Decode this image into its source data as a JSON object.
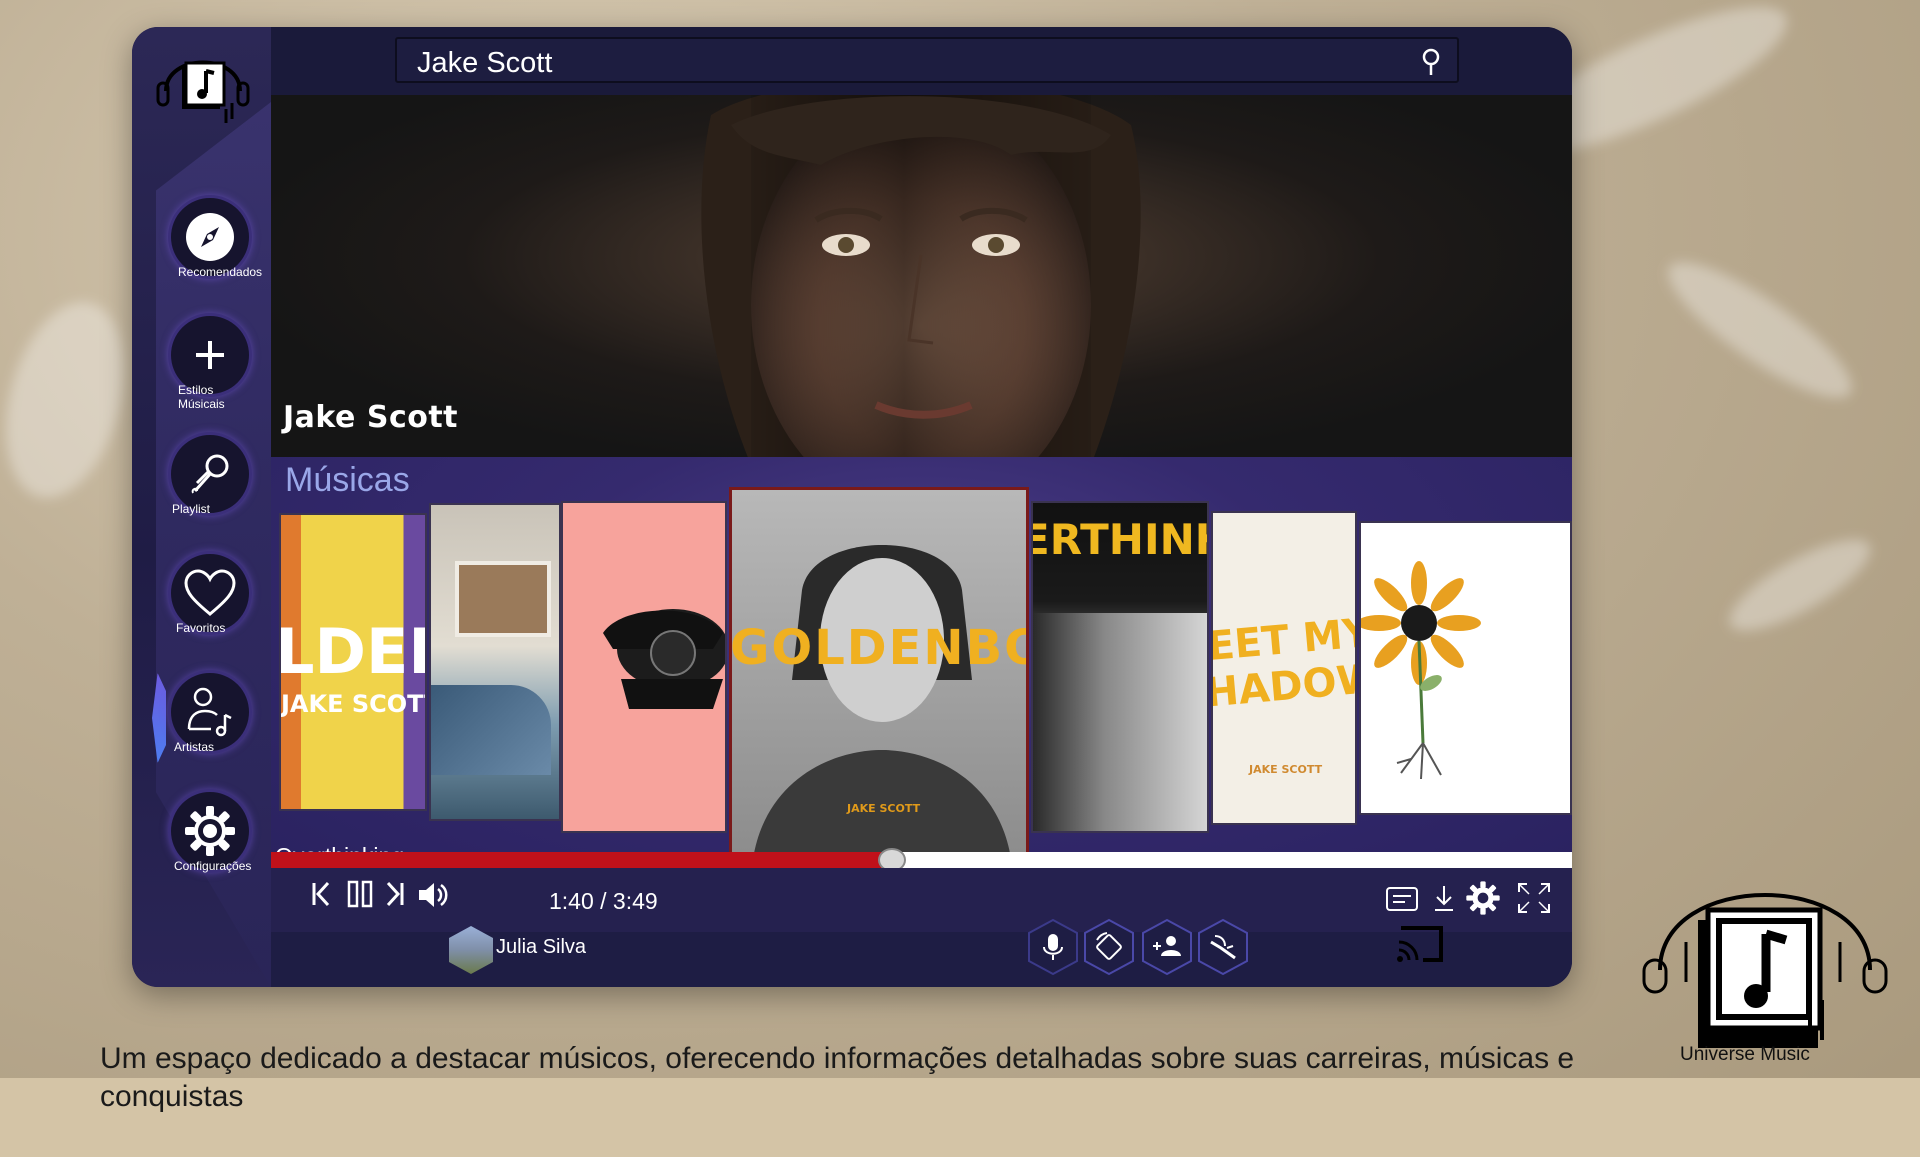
{
  "app": {
    "search": {
      "value": "Jake Scott"
    },
    "sidebar": {
      "items": [
        {
          "label": "Recomendados",
          "icon": "compass-icon"
        },
        {
          "label": "Estilos Músicais",
          "icon": "plus-icon"
        },
        {
          "label": "Playlist",
          "icon": "microphone-icon"
        },
        {
          "label": "Favoritos",
          "icon": "heart-icon"
        },
        {
          "label": "Artistas",
          "icon": "artist-icon"
        },
        {
          "label": "Configurações",
          "icon": "gear-icon"
        }
      ],
      "active_index": 4
    },
    "hero": {
      "artist_name": "Jake Scott"
    },
    "music": {
      "section_title": "Músicas",
      "covers": [
        {
          "text_line1": "LDEN",
          "text_line2": "JAKE SCOTT"
        },
        {
          "text_line1": ""
        },
        {
          "text_line1": ""
        },
        {
          "text_line1": "GOLDENBO",
          "text_line2": "JAKE SCOTT"
        },
        {
          "text_line1": "ERTHINKI"
        },
        {
          "text_line1": "EET MY",
          "text_line2": "HADOW",
          "text_line3": "JAKE SCOTT"
        },
        {
          "text_line1": ""
        }
      ],
      "now_playing": "Overthinking"
    },
    "player": {
      "progress": 0.4776,
      "time": "1:40 / 3:49"
    },
    "footer": {
      "username": "Julia Silva"
    }
  },
  "caption": "Um espaço dedicado a destacar músicos, oferecendo informações detalhadas sobre suas carreiras, músicas e conquistas",
  "brand": {
    "name": "Universe Music"
  },
  "colors": {
    "accent": "#c0111a",
    "sidebar": "#2c2856",
    "music_bg": "#352a6e",
    "title_blue": "#9aa7e8"
  }
}
